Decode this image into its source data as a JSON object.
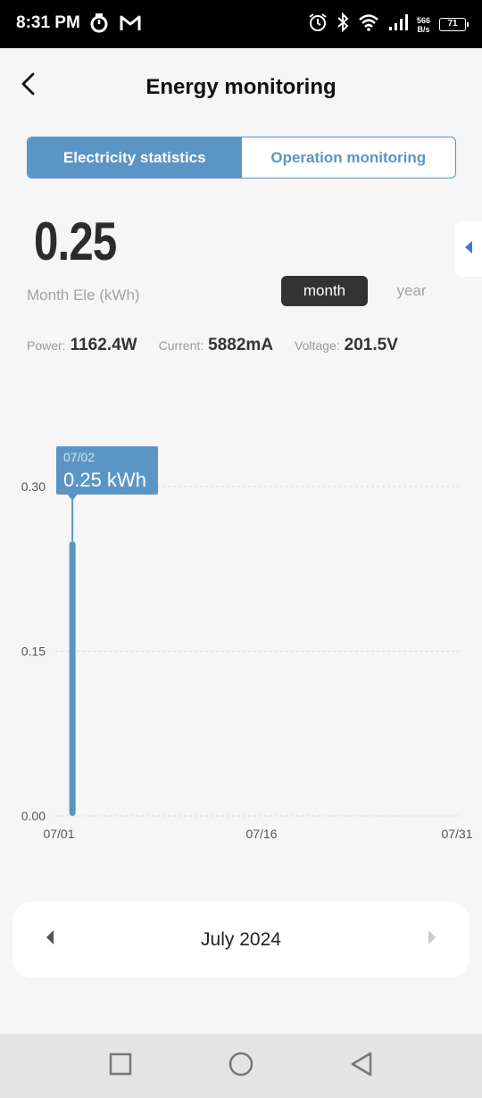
{
  "status_bar": {
    "time": "8:31 PM",
    "net_speed_value": "566",
    "net_speed_unit": "B/s",
    "battery": "71",
    "icons": [
      "pomodoro-icon",
      "gmail-icon",
      "alarm-icon",
      "bluetooth-icon",
      "wifi-icon",
      "signal-icon"
    ]
  },
  "header": {
    "title": "Energy monitoring",
    "back_icon": "chevron-left-icon"
  },
  "tabs": [
    {
      "label": "Electricity statistics",
      "active": true
    },
    {
      "label": "Operation monitoring",
      "active": false
    }
  ],
  "summary": {
    "value": "0.25",
    "label": "Month Ele (kWh)"
  },
  "period_toggle": {
    "month": "month",
    "year": "year",
    "selected": "month"
  },
  "metrics": {
    "power_label": "Power:",
    "power_value": "1162.4W",
    "current_label": "Current:",
    "current_value": "5882mA",
    "voltage_label": "Voltage:",
    "voltage_value": "201.5V"
  },
  "chart_data": {
    "type": "bar",
    "x_tick_labels": [
      "07/01",
      "07/16",
      "07/31"
    ],
    "y_tick_labels": [
      "0.30",
      "0.15",
      "0.00"
    ],
    "ylim": [
      0,
      0.3
    ],
    "grid": true,
    "bars": [
      {
        "x": "07/02",
        "value": 0.25
      }
    ],
    "tooltip": {
      "date": "07/02",
      "value": "0.25 kWh"
    },
    "bar_color": "#5b95c6"
  },
  "month_nav": {
    "label": "July 2024"
  },
  "colors": {
    "accent": "#5b95c6",
    "dark_toggle": "#333333"
  }
}
